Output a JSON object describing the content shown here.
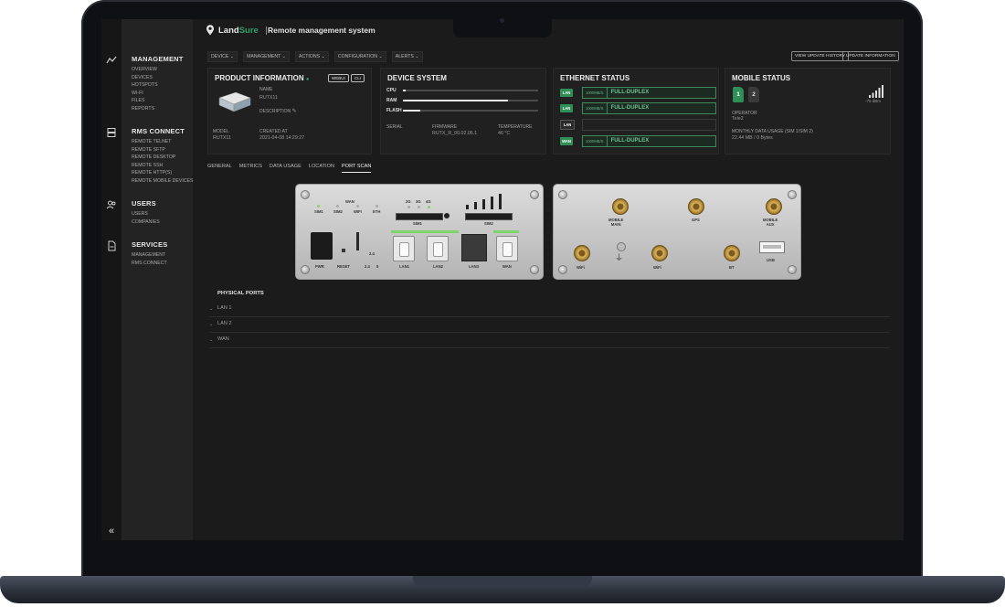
{
  "brand": {
    "name_part1": "Land",
    "name_part2": "Sure",
    "subtitle": "Remote management system"
  },
  "nav": {
    "sections": [
      {
        "title": "MANAGEMENT",
        "items": [
          "OVERVIEW",
          "DEVICES",
          "HOTSPOTS",
          "WI-FI",
          "FILES",
          "REPORTS"
        ]
      },
      {
        "title": "RMS CONNECT",
        "items": [
          "REMOTE TELNET",
          "REMOTE SFTP",
          "REMOTE DESKTOP",
          "REMOTE SSH",
          "REMOTE HTTP(S)",
          "REMOTE MOBILE DEVICES"
        ]
      },
      {
        "title": "USERS",
        "items": [
          "USERS",
          "COMPANIES"
        ]
      },
      {
        "title": "SERVICES",
        "items": [
          "MANAGEMENT",
          "RMS CONNECT"
        ]
      }
    ],
    "collapse_glyph": "«"
  },
  "menubar": [
    "DEVICE ⌄",
    "MANAGEMENT ⌄",
    "ACTIONS ⌄",
    "CONFIGURATION ⌄",
    "ALERTS ⌄"
  ],
  "top_buttons": {
    "history": "VIEW UPDATE HISTORY",
    "update": "UPDATE INFORMATION"
  },
  "product": {
    "title": "PRODUCT INFORMATION",
    "status_dot": "●",
    "webui": "WEBUI",
    "cli": "CLI",
    "name_label": "NAME",
    "name_value": "RUTX11",
    "description_label": "DESCRIPTION",
    "model_label": "MODEL",
    "model_value": "RUTX11",
    "created_label": "CREATED AT",
    "created_value": "2021-04-08 14:29:27"
  },
  "system": {
    "title": "DEVICE SYSTEM",
    "bars": [
      {
        "label": "CPU",
        "fill": 0.02
      },
      {
        "label": "RAM",
        "fill": 0.78
      },
      {
        "label": "FLASH",
        "fill": 0.13
      }
    ],
    "serial_label": "SERIAL",
    "firmware_label": "FIRMWARE",
    "firmware_value": "RUTX_R_00.02.06.1",
    "temperature_label": "TEMPERATURE",
    "temperature_value": "46 °C"
  },
  "ethernet": {
    "title": "ETHERNET STATUS",
    "rows": [
      {
        "tag": "LAN",
        "speed": "1000MB/S",
        "duplex": "FULL-DUPLEX",
        "active": true
      },
      {
        "tag": "LAN",
        "speed": "1000MB/S",
        "duplex": "FULL-DUPLEX",
        "active": true
      },
      {
        "tag": "LAN",
        "speed": "",
        "duplex": "",
        "active": false
      },
      {
        "tag": "WAN",
        "speed": "1000MB/S",
        "duplex": "FULL-DUPLEX",
        "active": true
      }
    ]
  },
  "mobile": {
    "title": "MOBILE STATUS",
    "sim1": "1",
    "sim2": "2",
    "signal": "-75 dBm",
    "signal_level": 5,
    "operator_label": "OPERATOR",
    "operator_value": "Tele2",
    "usage_label": "MONTHLY DATA USAGE (SIM 1/SIM 2)",
    "usage_value": "22.44 MB / 0 Bytes"
  },
  "tabs": [
    "GENERAL",
    "METRICS",
    "DATA USAGE",
    "LOCATION",
    "PORT SCAN"
  ],
  "active_tab": "PORT SCAN",
  "front_panel": {
    "wan": "WAN",
    "sim1": "SIM1",
    "sim2": "SIM2",
    "wifi": "WIFI",
    "eth": "ETH",
    "g2": "2G",
    "g3": "3G",
    "g4": "4G",
    "slot1": "SIM1",
    "slot2": "SIM2",
    "pwr": "PWR",
    "reset": "RESET",
    "wifi_24": "2.4",
    "wifi_24b": "2.4",
    "wifi_5": "5",
    "lan1": "LAN1",
    "lan2": "LAN2",
    "lan3": "LAN3",
    "wan_port": "WAN"
  },
  "back_panel": {
    "mobile_main": "MOBILE\nMAIN",
    "gps": "GPS",
    "mobile_aux": "MOBILE\nAUX",
    "wifi_a": "WiFi",
    "wifi_b": "WiFi",
    "bt": "BT",
    "usb": "USB"
  },
  "physical_ports": {
    "title": "PHYSICAL PORTS",
    "rows": [
      "LAN 1",
      "LAN 2",
      "WAN"
    ]
  },
  "colors": {
    "accent_green": "#2f9e6a",
    "tag_green": "#2f8f57",
    "tag_gray": "#2b2b2b"
  }
}
